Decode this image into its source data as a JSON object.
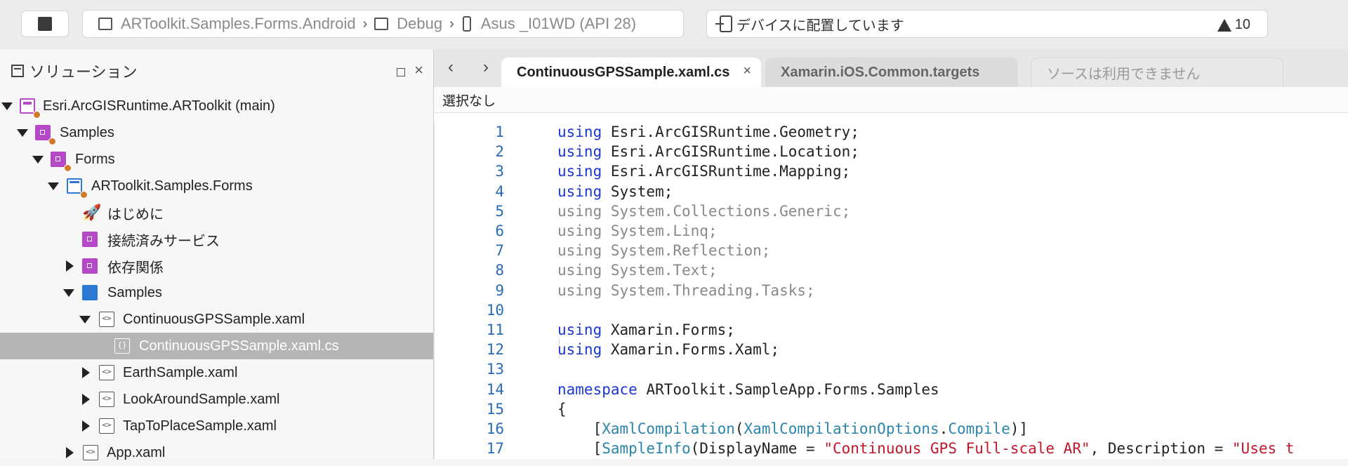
{
  "toolbar": {
    "breadcrumb": [
      {
        "label": "ARToolkit.Samples.Forms.Android",
        "icon": "window-icon"
      },
      {
        "label": "Debug",
        "icon": "window-icon"
      },
      {
        "label": "Asus _I01WD (API 28)",
        "icon": "phone-icon"
      }
    ],
    "status_text": "デバイスに配置しています",
    "warning_count": "10"
  },
  "sidebar": {
    "title": "ソリューション",
    "items": [
      {
        "label": "Esri.ArcGISRuntime.ARToolkit (main)",
        "icon": "solution-icon"
      },
      {
        "label": "Samples",
        "icon": "solution-folder-icon"
      },
      {
        "label": "Forms",
        "icon": "solution-folder-icon"
      },
      {
        "label": "ARToolkit.Samples.Forms",
        "icon": "csharp-project-icon"
      },
      {
        "label": "はじめに",
        "icon": "rocket-icon"
      },
      {
        "label": "接続済みサービス",
        "icon": "connected-services-icon"
      },
      {
        "label": "依存関係",
        "icon": "dependencies-icon"
      },
      {
        "label": "Samples",
        "icon": "folder-icon"
      },
      {
        "label": "ContinuousGPSSample.xaml",
        "icon": "xaml-file-icon"
      },
      {
        "label": "ContinuousGPSSample.xaml.cs",
        "icon": "cs-file-icon"
      },
      {
        "label": "EarthSample.xaml",
        "icon": "xaml-file-icon"
      },
      {
        "label": "LookAroundSample.xaml",
        "icon": "xaml-file-icon"
      },
      {
        "label": "TapToPlaceSample.xaml",
        "icon": "xaml-file-icon"
      },
      {
        "label": "App.xaml",
        "icon": "xaml-file-icon"
      }
    ]
  },
  "editor": {
    "tabs": [
      {
        "label": "ContinuousGPSSample.xaml.cs",
        "active": true
      },
      {
        "label": "Xamarin.iOS.Common.targets",
        "active": false
      },
      {
        "label": "ソースは利用できません",
        "active": false
      }
    ],
    "selection": "選択なし",
    "lines": [
      {
        "n": "1",
        "t": [
          [
            "kw",
            "using"
          ],
          [
            "",
            "Esri.ArcGISRuntime.Geometry;"
          ]
        ]
      },
      {
        "n": "2",
        "t": [
          [
            "kw",
            "using"
          ],
          [
            "",
            "Esri.ArcGISRuntime.Location;"
          ]
        ]
      },
      {
        "n": "3",
        "t": [
          [
            "kw",
            "using"
          ],
          [
            "",
            "Esri.ArcGISRuntime.Mapping;"
          ]
        ]
      },
      {
        "n": "4",
        "t": [
          [
            "kw",
            "using"
          ],
          [
            "",
            "System;"
          ]
        ]
      },
      {
        "n": "5",
        "t": [
          [
            "dim",
            "using"
          ],
          [
            "dim",
            "System.Collections.Generic;"
          ]
        ]
      },
      {
        "n": "6",
        "t": [
          [
            "dim",
            "using"
          ],
          [
            "dim",
            "System.Linq;"
          ]
        ]
      },
      {
        "n": "7",
        "t": [
          [
            "dim",
            "using"
          ],
          [
            "dim",
            "System.Reflection;"
          ]
        ]
      },
      {
        "n": "8",
        "t": [
          [
            "dim",
            "using"
          ],
          [
            "dim",
            "System.Text;"
          ]
        ]
      },
      {
        "n": "9",
        "t": [
          [
            "dim",
            "using"
          ],
          [
            "dim",
            "System.Threading.Tasks;"
          ]
        ]
      },
      {
        "n": "10",
        "t": []
      },
      {
        "n": "11",
        "t": [
          [
            "kw",
            "using"
          ],
          [
            "",
            "Xamarin.Forms;"
          ]
        ]
      },
      {
        "n": "12",
        "t": [
          [
            "kw",
            "using"
          ],
          [
            "",
            "Xamarin.Forms.Xaml;"
          ]
        ]
      },
      {
        "n": "13",
        "t": []
      },
      {
        "n": "14",
        "t": [
          [
            "kw",
            "namespace"
          ],
          [
            "",
            "ARToolkit.SampleApp.Forms.Samples"
          ]
        ]
      },
      {
        "n": "15",
        "t": [
          [
            "",
            "{"
          ]
        ]
      },
      {
        "n": "16",
        "t": [
          [
            "",
            "    ["
          ],
          [
            "ty",
            "XamlCompilation"
          ],
          [
            "",
            "("
          ],
          [
            "ty",
            "XamlCompilationOptions"
          ],
          [
            "",
            "."
          ],
          [
            "ty",
            "Compile"
          ],
          [
            "",
            ")]"
          ]
        ]
      },
      {
        "n": "17",
        "t": [
          [
            "",
            "    ["
          ],
          [
            "ty",
            "SampleInfo"
          ],
          [
            "",
            "(DisplayName = "
          ],
          [
            "str",
            "\"Continuous GPS Full-scale AR\""
          ],
          [
            "",
            ", Description = "
          ],
          [
            "str",
            "\"Uses t"
          ]
        ]
      }
    ]
  }
}
